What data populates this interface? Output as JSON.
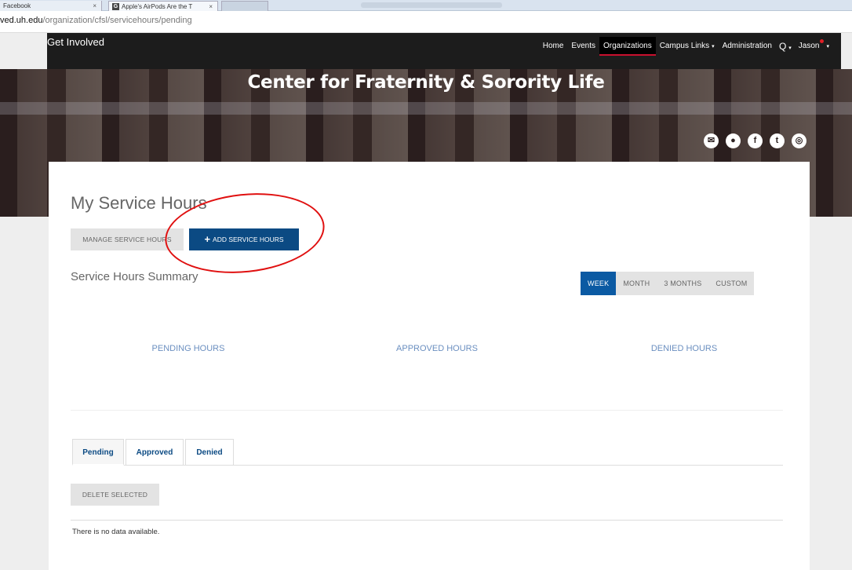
{
  "browser": {
    "tabs": [
      {
        "label": "Facebook",
        "close": "×"
      },
      {
        "icon": "G",
        "label": "Apple's AirPods Are the T",
        "close": "×"
      },
      {
        "label": ""
      }
    ],
    "url_domain": "ved.uh.edu",
    "url_path": "/organization/cfsl/servicehours/pending"
  },
  "nav": {
    "brand": "Get Involved",
    "links": {
      "home": "Home",
      "events": "Events",
      "organizations": "Organizations",
      "campus_links": "Campus Links",
      "administration": "Administration",
      "user": "Jason"
    },
    "caret": "▾",
    "search_glyph": "Q"
  },
  "hero": {
    "title": "Center for Fraternity & Sorority Life",
    "social": {
      "email": "✉",
      "web": "●",
      "facebook": "f",
      "twitter": "t",
      "instagram": "◎"
    }
  },
  "main": {
    "page_title": "My Service Hours",
    "manage_label": "MANAGE SERVICE HOURS",
    "add_label": "ADD SERVICE HOURS",
    "add_glyph": "+",
    "summary_title": "Service Hours Summary",
    "range": {
      "week": "WEEK",
      "month": "MONTH",
      "three_months": "3 MONTHS",
      "custom": "CUSTOM"
    },
    "stats": {
      "pending": "PENDING HOURS",
      "approved": "APPROVED HOURS",
      "denied": "DENIED HOURS"
    },
    "tabs": {
      "pending": "Pending",
      "approved": "Approved",
      "denied": "Denied"
    },
    "delete_label": "DELETE SELECTED",
    "empty_text": "There is no data available."
  },
  "colors": {
    "nav_bg": "#1c1c1c",
    "primary": "#0b4a83",
    "active_range": "#0b5aa3",
    "annotation": "#e01010",
    "stat_text": "#6b8fc0"
  }
}
